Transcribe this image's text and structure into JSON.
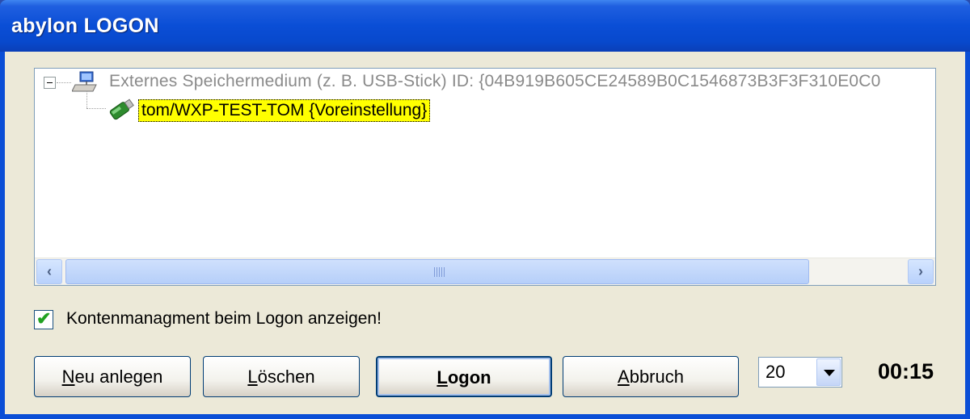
{
  "window": {
    "title": "abylon LOGON"
  },
  "tree": {
    "root_label": "Externes Speichermedium (z. B. USB-Stick) ID: {04B919B605CE24589B0C1546873B3F3F310E0C0",
    "child_label": "tom/WXP-TEST-TOM {Voreinstellung}"
  },
  "checkbox": {
    "label": "Kontenmanagment beim Logon anzeigen!",
    "checked": true
  },
  "buttons": {
    "new": {
      "label_u": "N",
      "label_rest": "eu anlegen"
    },
    "delete": {
      "label_u": "L",
      "label_rest": "öschen"
    },
    "logon": {
      "label_u": "L",
      "label_rest": "ogon"
    },
    "cancel": {
      "label_u": "A",
      "label_rest": "bbruch"
    }
  },
  "timeout_select": {
    "value": "20"
  },
  "timer": {
    "value": "00:15"
  },
  "icons": {
    "root": "computer-icon",
    "child": "usb-stick-icon",
    "checkmark": "checkmark-icon"
  }
}
